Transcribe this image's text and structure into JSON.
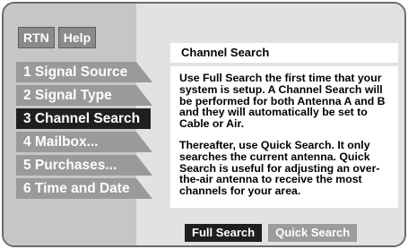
{
  "topbar": {
    "rtn_label": "RTN",
    "help_label": "Help"
  },
  "menu": {
    "items": [
      {
        "label": "1 Signal Source"
      },
      {
        "label": "2 Signal Type"
      },
      {
        "label": "3 Channel Search"
      },
      {
        "label": "4 Mailbox..."
      },
      {
        "label": "5 Purchases..."
      },
      {
        "label": "6 Time and Date"
      }
    ],
    "active_index": 2
  },
  "panel": {
    "title": "Channel Search",
    "paragraph1": "Use Full Search the first time that your system is setup. A Channel Search will be performed for both Antenna A and B and they will automatically be set to Cable or Air.",
    "paragraph2": "Thereafter, use Quick Search. It only searches the current antenna. Quick Search is useful for adjusting an over-the-air antenna to receive the most channels for your area."
  },
  "actions": {
    "full_search": "Full Search",
    "quick_search": "Quick Search"
  },
  "colors": {
    "sidebar": "#c6c6c6",
    "main": "#e2e2e2",
    "active": "#1f1f1f",
    "inactive": "#9a9a9a"
  }
}
